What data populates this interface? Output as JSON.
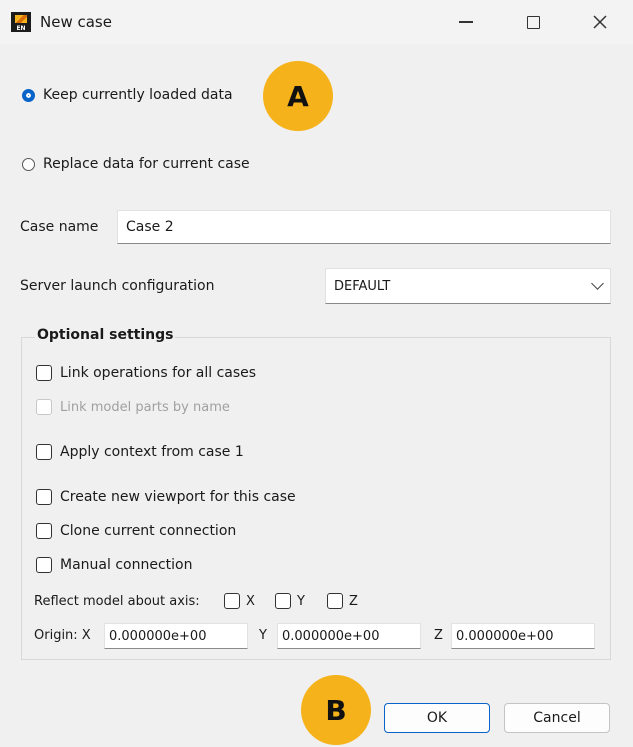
{
  "window": {
    "title": "New case",
    "app_icon": "ensight-app-icon",
    "app_icon_text": "EN",
    "controls": [
      "minimize-icon",
      "maximize-icon",
      "close-icon"
    ]
  },
  "data_mode": {
    "options": [
      {
        "label": "Keep currently loaded data",
        "selected": true
      },
      {
        "label": "Replace data for current case",
        "selected": false
      }
    ]
  },
  "markers": {
    "a": "A",
    "b": "B",
    "color": "#f6b21b"
  },
  "case_name": {
    "label": "Case name",
    "value": "Case 2"
  },
  "server_launch": {
    "label": "Server launch configuration",
    "value": "DEFAULT"
  },
  "optional": {
    "title": "Optional settings",
    "link_operations": {
      "label": "Link operations for all cases",
      "checked": false
    },
    "link_model_parts": {
      "label": "Link model parts by name",
      "checked": false,
      "disabled": true
    },
    "apply_context": {
      "label": "Apply context from case 1",
      "checked": false
    },
    "create_viewport": {
      "label": "Create new viewport for this case",
      "checked": false
    },
    "clone_connection": {
      "label": "Clone current connection",
      "checked": false
    },
    "manual_connection": {
      "label": "Manual connection",
      "checked": false
    },
    "reflect": {
      "label": "Reflect model about axis:",
      "axes": [
        {
          "label": "X",
          "checked": false
        },
        {
          "label": "Y",
          "checked": false
        },
        {
          "label": "Z",
          "checked": false
        }
      ]
    },
    "origin": {
      "label": "Origin: X",
      "x": "0.000000e+00",
      "y_label": "Y",
      "y": "0.000000e+00",
      "z_label": "Z",
      "z": "0.000000e+00"
    }
  },
  "buttons": {
    "ok": "OK",
    "cancel": "Cancel"
  },
  "accent_color": "#0a63c9"
}
